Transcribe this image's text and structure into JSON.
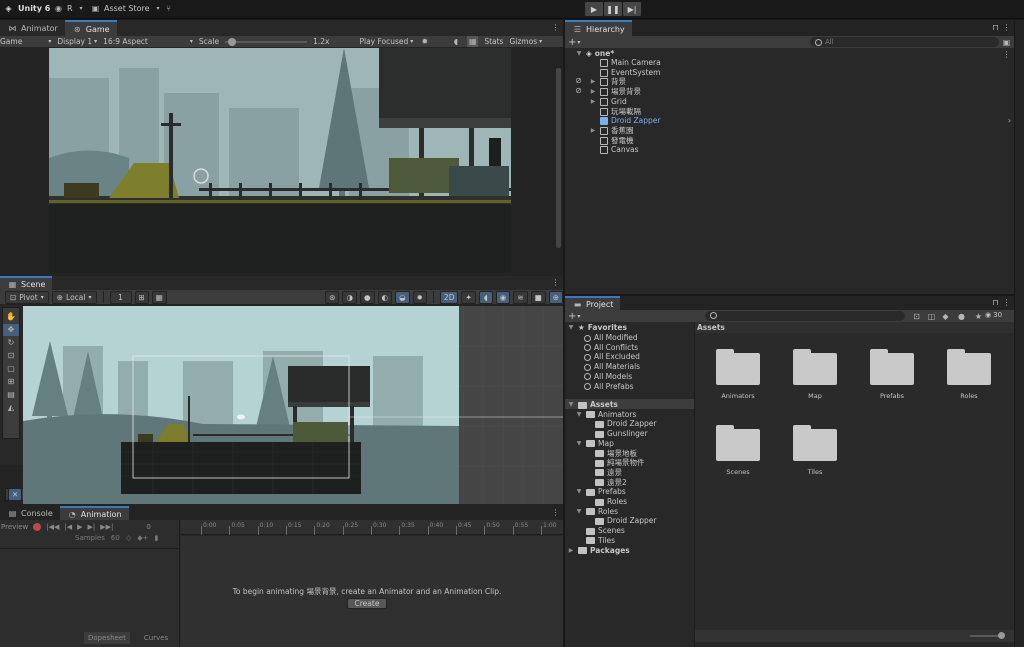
{
  "topbar": {
    "app_name": "Unity 6",
    "account_label": "R",
    "asset_store": "Asset Store"
  },
  "game_panel": {
    "tabs": [
      {
        "label": "Animator"
      },
      {
        "label": "Game"
      }
    ],
    "toolbar": {
      "mode": "Game",
      "display": "Display 1",
      "aspect": "16:9 Aspect",
      "scale_label": "Scale",
      "scale_value": "1.2x",
      "play_focused": "Play Focused",
      "stats": "Stats",
      "gizmos": "Gizmos"
    }
  },
  "scene_panel": {
    "tab": "Scene",
    "toolbar": {
      "pivot": "Pivot",
      "local": "Local",
      "grid_value": "1",
      "mode_2d": "2D"
    }
  },
  "hierarchy": {
    "tab": "Hierarchy",
    "search_placeholder": "All",
    "scene_name": "one*",
    "items": [
      {
        "label": "Main Camera",
        "expandable": false,
        "hidden": false
      },
      {
        "label": "EventSystem",
        "expandable": false,
        "hidden": false
      },
      {
        "label": "背景",
        "expandable": true,
        "hidden": true
      },
      {
        "label": "場景背景",
        "expandable": true,
        "hidden": true
      },
      {
        "label": "Grid",
        "expandable": true,
        "hidden": false
      },
      {
        "label": "玩場載隔",
        "expandable": false,
        "hidden": false
      },
      {
        "label": "Droid Zapper",
        "expandable": false,
        "hidden": false,
        "selected": true
      },
      {
        "label": "香蕉園",
        "expandable": true,
        "hidden": false
      },
      {
        "label": "發電機",
        "expandable": false,
        "hidden": false
      },
      {
        "label": "Canvas",
        "expandable": false,
        "hidden": false
      }
    ]
  },
  "project": {
    "tab": "Project",
    "count_badge": "30",
    "favorites": {
      "label": "Favorites",
      "items": [
        "All Modified",
        "All Conflicts",
        "All Excluded",
        "All Materials",
        "All Models",
        "All Prefabs"
      ]
    },
    "tree": [
      {
        "label": "Assets",
        "depth": 0,
        "bold": true
      },
      {
        "label": "Animators",
        "depth": 1
      },
      {
        "label": "Droid Zapper",
        "depth": 2
      },
      {
        "label": "Gunslinger",
        "depth": 2
      },
      {
        "label": "Map",
        "depth": 1
      },
      {
        "label": "場景地板",
        "depth": 2
      },
      {
        "label": "純場景物件",
        "depth": 2
      },
      {
        "label": "遠景",
        "depth": 2
      },
      {
        "label": "遠景2",
        "depth": 2
      },
      {
        "label": "Prefabs",
        "depth": 1
      },
      {
        "label": "Roles",
        "depth": 2
      },
      {
        "label": "Roles",
        "depth": 1
      },
      {
        "label": "Droid Zapper",
        "depth": 2
      },
      {
        "label": "Scenes",
        "depth": 1
      },
      {
        "label": "Tiles",
        "depth": 1
      },
      {
        "label": "Packages",
        "depth": 0,
        "bold": true
      }
    ],
    "breadcrumb": "Assets",
    "assets": [
      "Animators",
      "Map",
      "Prefabs",
      "Roles",
      "Scenes",
      "Tiles"
    ]
  },
  "animation_panel": {
    "tabs": [
      {
        "label": "Console"
      },
      {
        "label": "Animation"
      }
    ],
    "preview_label": "Preview",
    "samples_label": "Samples",
    "samples_value": "60",
    "frame_value": "0",
    "timeline_ticks": [
      "0:00",
      "0:05",
      "0:10",
      "0:15",
      "0:20",
      "0:25",
      "0:30",
      "0:35",
      "0:40",
      "0:45",
      "0:50",
      "0:55",
      "1:00"
    ],
    "empty_message": "To begin animating 場景背景, create an Animator and an Animation Clip.",
    "create_button": "Create",
    "bottom_tabs": [
      "Dopesheet",
      "Curves"
    ]
  },
  "colors": {
    "accent": "#3a79bb",
    "selected_text": "#7bb0ef",
    "panel_bg": "#282828",
    "sky_game": "#9fb6b6",
    "sky_scene": "#b6d3d3"
  }
}
